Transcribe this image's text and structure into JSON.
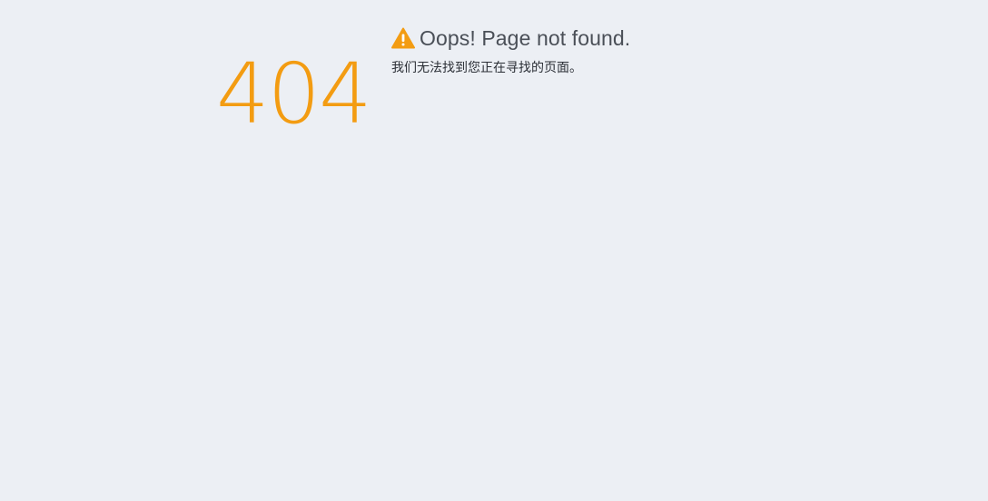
{
  "error": {
    "code": "404",
    "headline": "Oops! Page not found.",
    "message": "我们无法找到您正在寻找的页面。",
    "icon": "warning-icon"
  },
  "colors": {
    "background": "#ECEFF4",
    "accent": "#F39C12",
    "headline": "#4A4F57",
    "text": "#2B2F36"
  }
}
